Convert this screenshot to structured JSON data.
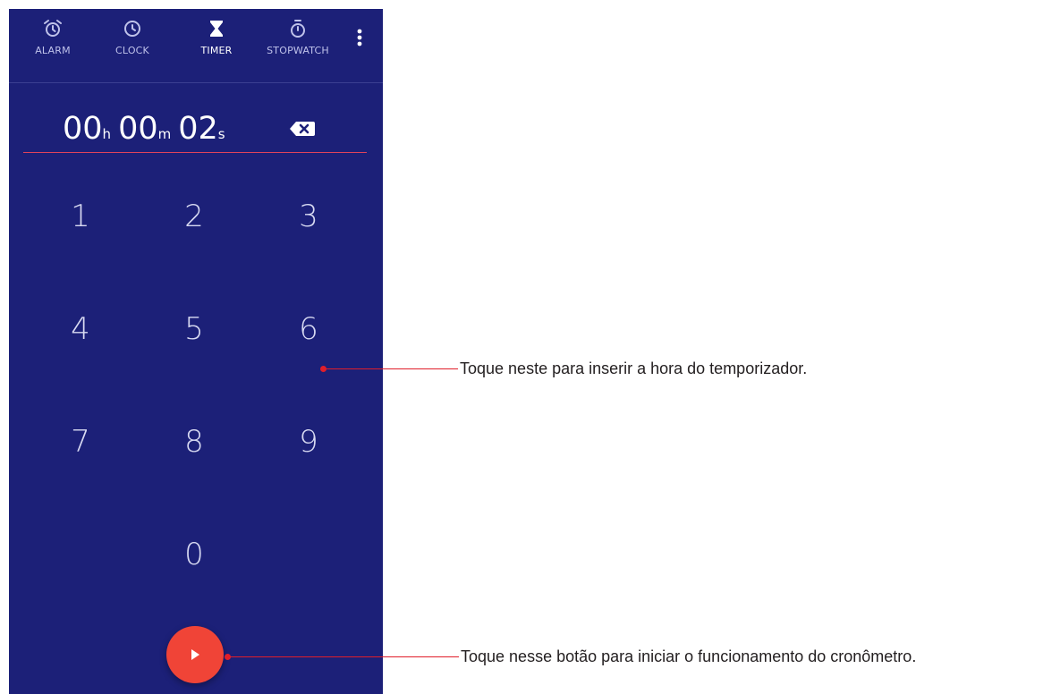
{
  "tabs": [
    {
      "label": "ALARM",
      "icon": "alarm-clock-icon",
      "active": false
    },
    {
      "label": "CLOCK",
      "icon": "clock-icon",
      "active": false
    },
    {
      "label": "TIMER",
      "icon": "hourglass-icon",
      "active": true
    },
    {
      "label": "STOPWATCH",
      "icon": "stopwatch-icon",
      "active": false
    }
  ],
  "menu": {
    "icon": "more-vert-icon"
  },
  "timer": {
    "hours": "00",
    "hours_unit": "h",
    "minutes": "00",
    "minutes_unit": "m",
    "seconds": "02",
    "seconds_unit": "s",
    "backspace_icon": "backspace-icon"
  },
  "keypad": {
    "keys": [
      "1",
      "2",
      "3",
      "4",
      "5",
      "6",
      "7",
      "8",
      "9",
      "0"
    ]
  },
  "start_button": {
    "icon": "play-icon"
  },
  "annotations": [
    {
      "text": "Toque neste para inserir a hora do temporizador."
    },
    {
      "text": "Toque nesse botão para iniciar o funcionamento do cronômetro."
    }
  ],
  "colors": {
    "background": "#1c2078",
    "accent": "#f04437",
    "underline": "#e0435b",
    "callout": "#e01e2a"
  }
}
